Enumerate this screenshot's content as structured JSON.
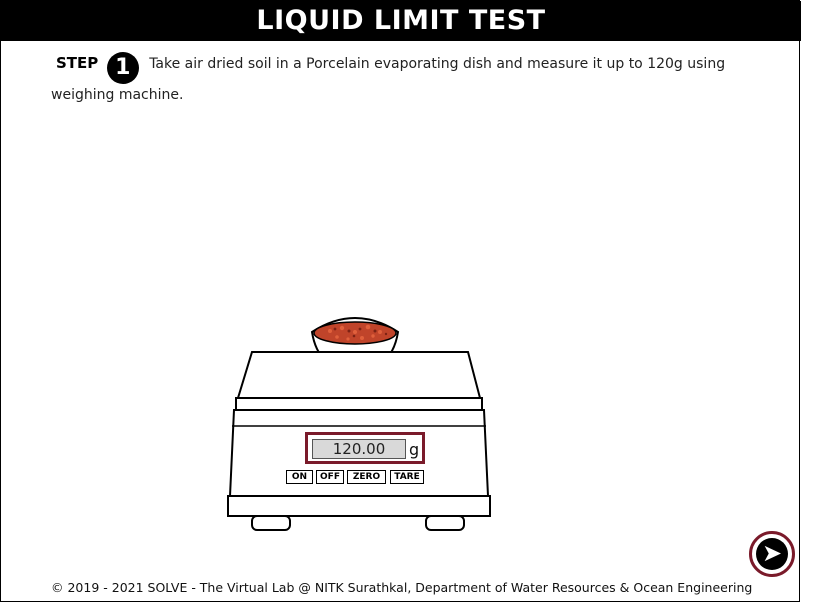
{
  "header": {
    "title": "LIQUID LIMIT TEST"
  },
  "step": {
    "label": "STEP",
    "number": "1",
    "instruction": "Take air dried soil in a Porcelain evaporating dish and measure it up to 120g using weighing machine."
  },
  "scale": {
    "reading": "120.00",
    "unit": "g",
    "buttons": {
      "on": "ON",
      "off": "OFF",
      "zero": "ZERO",
      "tare": "TARE"
    }
  },
  "navigation": {
    "next_icon": "play-icon",
    "next_symbol": "➤"
  },
  "colors": {
    "accent": "#7a1a2a",
    "soil": "#c0442a"
  },
  "footer": {
    "text": "© 2019 - 2021 SOLVE - The Virtual Lab @ NITK Surathkal, Department of Water Resources & Ocean Engineering"
  }
}
